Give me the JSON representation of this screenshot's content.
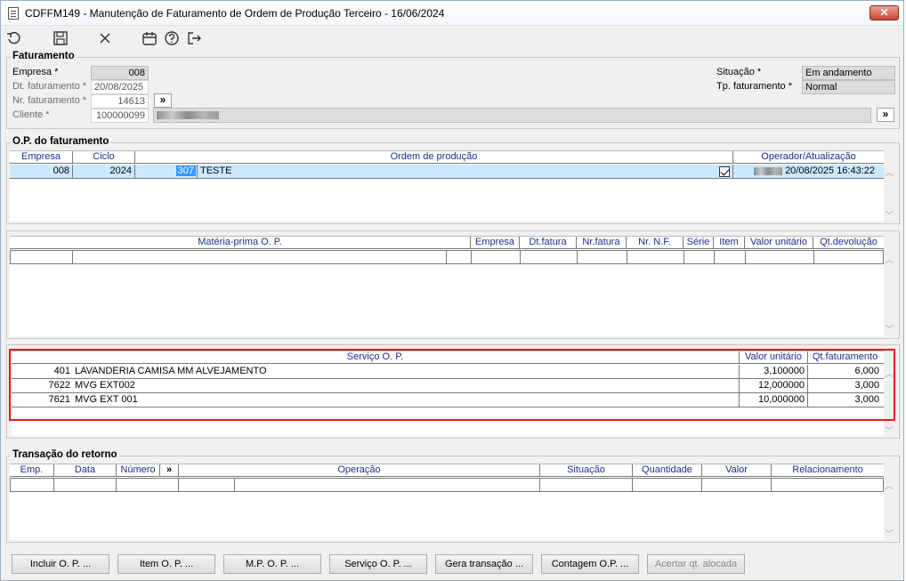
{
  "window": {
    "title": "CDFFM149 - Manutenção de Faturamento de Ordem de Produção Terceiro - 16/06/2024",
    "close_label": "✕"
  },
  "toolbar": {
    "icons": [
      "undo-icon",
      "save-icon",
      "cancel-icon",
      "calendar-icon",
      "help-icon",
      "exit-icon"
    ]
  },
  "faturamento": {
    "title": "Faturamento",
    "empresa_label": "Empresa *",
    "empresa_value": "008",
    "dt_faturamento_label": "Dt. faturamento *",
    "dt_faturamento_value": "20/08/2025",
    "nr_faturamento_label": "Nr. faturamento *",
    "nr_faturamento_value": "14613",
    "cliente_label": "Cliente *",
    "cliente_value": "100000099",
    "situacao_label": "Situação *",
    "situacao_value": "Em andamento",
    "tp_faturamento_label": "Tp. faturamento *",
    "tp_faturamento_value": "Normal",
    "arrow": "»"
  },
  "op_faturamento": {
    "title": "O.P. do faturamento",
    "headers": [
      "Empresa",
      "Ciclo",
      "Ordem de produção",
      "Operador/Atualização"
    ],
    "rows": [
      {
        "empresa": "008",
        "ciclo": "2024",
        "op_num": "307",
        "op_desc": "TESTE",
        "atualizacao": "20/08/2025 16:43:22"
      }
    ]
  },
  "materia_prima": {
    "headers": [
      "Matéria-prima O. P.",
      "Empresa",
      "Dt.fatura",
      "Nr.fatura",
      "Nr. N.F.",
      "Série",
      "Item",
      "Valor unitário",
      "Qt.devolução"
    ]
  },
  "servico": {
    "headers": [
      "Serviço O. P.",
      "Valor unitário",
      "Qt.faturamento"
    ],
    "rows": [
      {
        "code": "401",
        "desc": "LAVANDERIA CAMISA MM ALVEJAMENTO",
        "valor": "3,100000",
        "qt": "6,000"
      },
      {
        "code": "7622",
        "desc": "MVG EXT002",
        "valor": "12,000000",
        "qt": "3,000"
      },
      {
        "code": "7621",
        "desc": "MVG EXT 001",
        "valor": "10,000000",
        "qt": "3,000"
      }
    ]
  },
  "transacao": {
    "title": "Transação do retorno",
    "headers": [
      "Emp.",
      "Data",
      "Número",
      "»",
      "Operação",
      "Situação",
      "Quantidade",
      "Valor",
      "Relacionamento"
    ]
  },
  "buttons": [
    "Incluir O. P. ...",
    "Item O. P. ...",
    "M.P. O. P. ...",
    "Serviço O. P. ...",
    "Gera transação ...",
    "Contagem O.P. ...",
    "Acertar qt. alocada"
  ]
}
